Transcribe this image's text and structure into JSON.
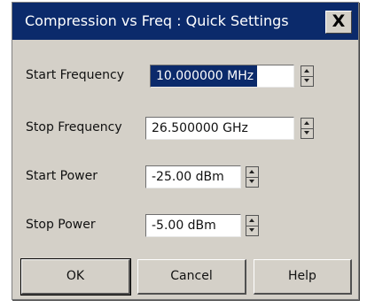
{
  "window": {
    "title": "Compression vs Freq : Quick Settings",
    "close_label": "X"
  },
  "fields": {
    "start_frequency": {
      "label": "Start Frequency",
      "value": "10.000000 MHz"
    },
    "stop_frequency": {
      "label": "Stop Frequency",
      "value": "26.500000 GHz"
    },
    "start_power": {
      "label": "Start Power",
      "value": "-25.00 dBm"
    },
    "stop_power": {
      "label": "Stop Power",
      "value": "-5.00 dBm"
    }
  },
  "buttons": {
    "ok": "OK",
    "cancel": "Cancel",
    "help": "Help"
  },
  "colors": {
    "titlebar": "#0b2a6b",
    "dialog_face": "#d4d0c8",
    "selection": "#0b2a6b"
  },
  "icons": {
    "close": "close-icon",
    "spinner_up": "chevron-up-icon",
    "spinner_down": "chevron-down-icon"
  }
}
